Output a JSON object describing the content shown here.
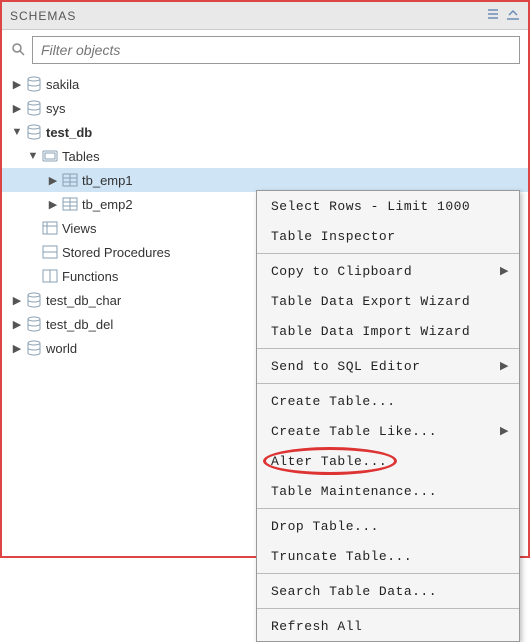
{
  "header": {
    "title": "SCHEMAS"
  },
  "search": {
    "placeholder": "Filter objects"
  },
  "tree": {
    "sakila": "sakila",
    "sys": "sys",
    "test_db": "test_db",
    "tables": "Tables",
    "tb_emp1": "tb_emp1",
    "tb_emp2": "tb_emp2",
    "views": "Views",
    "stored_procedures": "Stored Procedures",
    "functions": "Functions",
    "test_db_char": "test_db_char",
    "test_db_del": "test_db_del",
    "world": "world"
  },
  "menu": {
    "select_rows": "Select Rows - Limit 1000",
    "table_inspector": "Table Inspector",
    "copy_clipboard": "Copy to Clipboard",
    "data_export": "Table Data Export Wizard",
    "data_import": "Table Data Import Wizard",
    "send_sql": "Send to SQL Editor",
    "create_table": "Create Table...",
    "create_table_like": "Create Table Like...",
    "alter_table": "Alter Table...",
    "table_maintenance": "Table Maintenance...",
    "drop_table": "Drop Table...",
    "truncate_table": "Truncate Table...",
    "search_table_data": "Search Table Data...",
    "refresh_all": "Refresh All"
  }
}
